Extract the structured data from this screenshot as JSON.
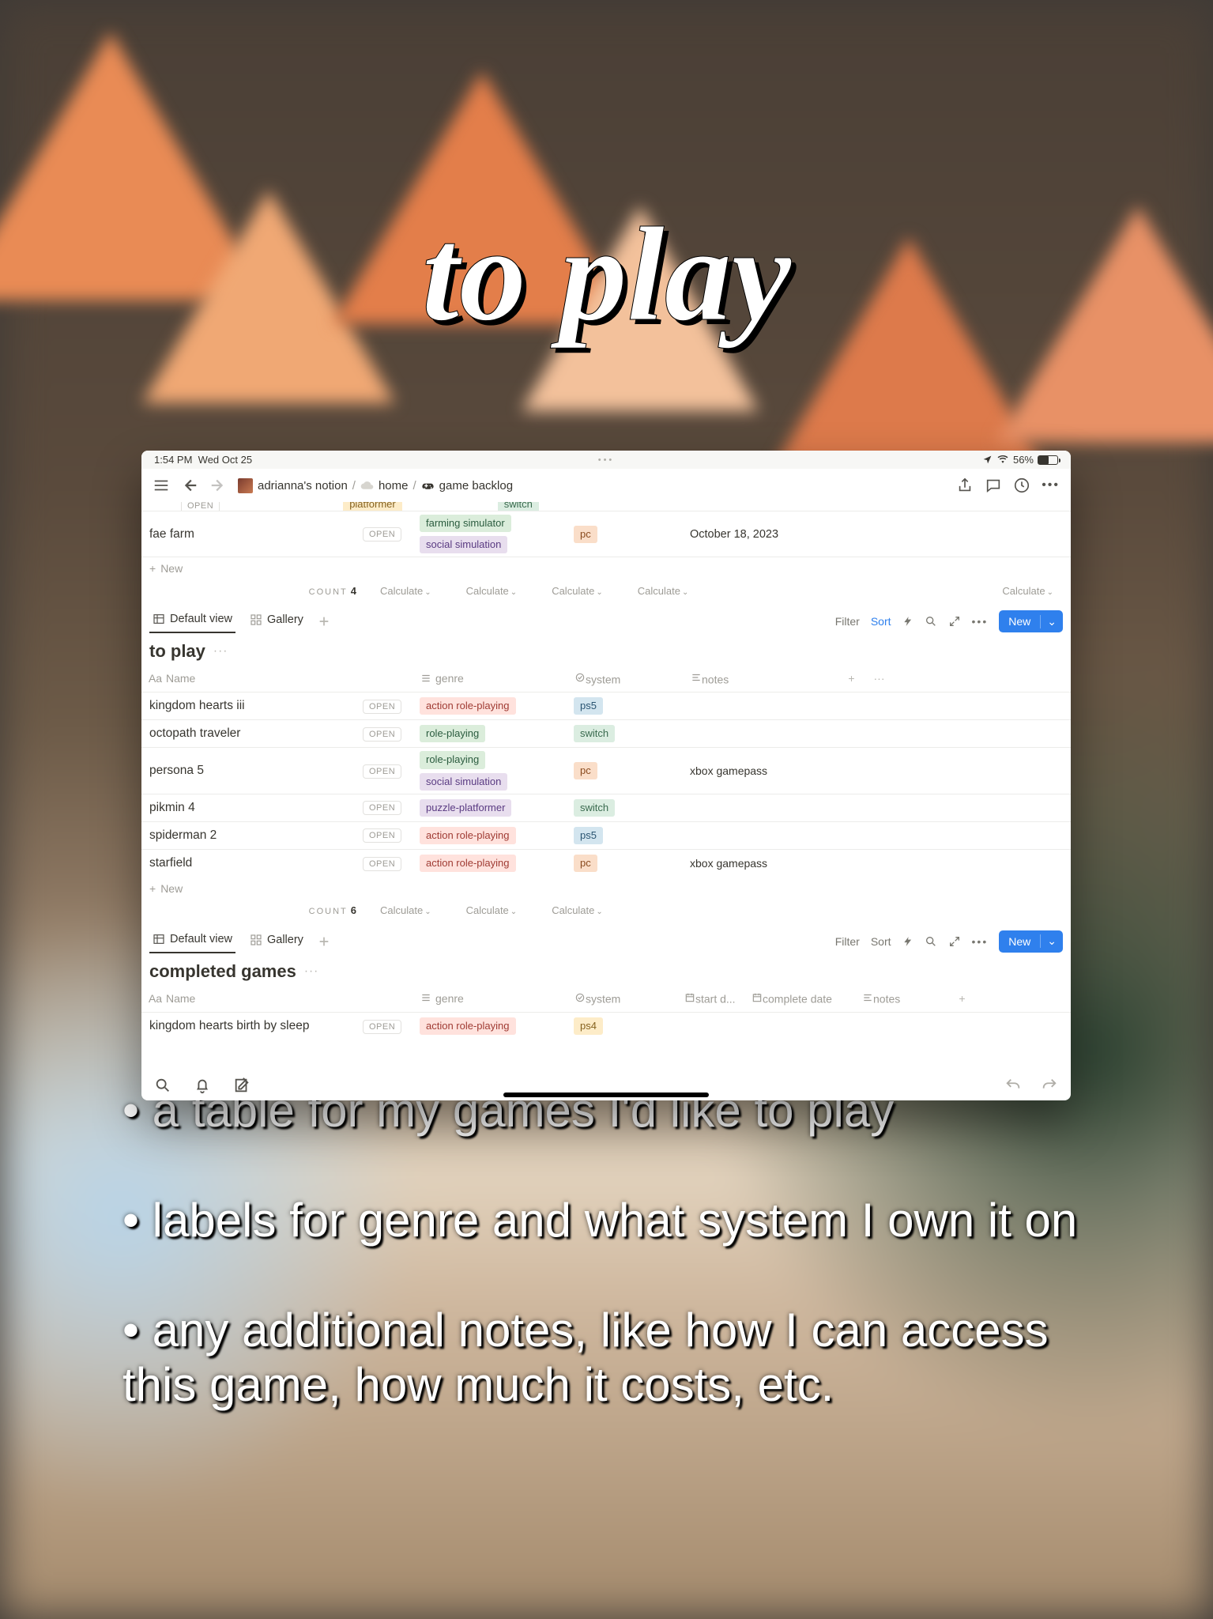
{
  "overlay": {
    "title": "to play",
    "bullets": [
      "• a table for my games I'd like to play",
      "• labels for genre and what system I own it on",
      "• any additional notes, like how I can access this game, how much it costs, etc."
    ]
  },
  "status": {
    "time": "1:54 PM",
    "date": "Wed Oct 25",
    "battery": "56%"
  },
  "breadcrumbs": {
    "workspace": "adrianna's notion",
    "parent": "home",
    "page": "game backlog",
    "sep": "/"
  },
  "partialTop": {
    "name": "fae farm",
    "open": "OPEN",
    "genres": [
      {
        "label": "farming simulator",
        "color": "green"
      },
      {
        "label": "social simulation",
        "color": "purple"
      }
    ],
    "system": {
      "label": "pc",
      "color": "orange"
    },
    "date": "October 18, 2023",
    "cutoffTag": {
      "label": "switch",
      "color": "ltgreen"
    }
  },
  "new_row_label": "New",
  "count_label": "COUNT",
  "calculate_label": "Calculate",
  "topSummary": {
    "count": "4"
  },
  "views": {
    "default": "Default view",
    "gallery": "Gallery",
    "filter": "Filter",
    "sort": "Sort",
    "new": "New"
  },
  "db2": {
    "title": "to play",
    "headers": {
      "name": "Name",
      "genre": "genre",
      "system": "system",
      "notes": "notes"
    },
    "rows": [
      {
        "name": "kingdom hearts iii",
        "open": "OPEN",
        "genres": [
          {
            "label": "action role-playing",
            "color": "red"
          }
        ],
        "system": {
          "label": "ps5",
          "color": "blue"
        },
        "notes": ""
      },
      {
        "name": "octopath traveler",
        "open": "OPEN",
        "genres": [
          {
            "label": "role-playing",
            "color": "green"
          }
        ],
        "system": {
          "label": "switch",
          "color": "ltgreen"
        },
        "notes": ""
      },
      {
        "name": "persona 5",
        "open": "OPEN",
        "genres": [
          {
            "label": "role-playing",
            "color": "green"
          },
          {
            "label": "social simulation",
            "color": "purple"
          }
        ],
        "system": {
          "label": "pc",
          "color": "orange"
        },
        "notes": "xbox gamepass"
      },
      {
        "name": "pikmin 4",
        "open": "OPEN",
        "genres": [
          {
            "label": "puzzle-platformer",
            "color": "purple"
          }
        ],
        "system": {
          "label": "switch",
          "color": "ltgreen"
        },
        "notes": ""
      },
      {
        "name": "spiderman 2",
        "open": "OPEN",
        "genres": [
          {
            "label": "action role-playing",
            "color": "red"
          }
        ],
        "system": {
          "label": "ps5",
          "color": "blue"
        },
        "notes": ""
      },
      {
        "name": "starfield",
        "open": "OPEN",
        "genres": [
          {
            "label": "action role-playing",
            "color": "red"
          }
        ],
        "system": {
          "label": "pc",
          "color": "orange"
        },
        "notes": "xbox gamepass"
      }
    ],
    "count": "6"
  },
  "db3": {
    "title": "completed games",
    "headers": {
      "name": "Name",
      "genre": "genre",
      "system": "system",
      "startd": "start d...",
      "complete": "complete date",
      "notes": "notes"
    },
    "rows": [
      {
        "name": "kingdom hearts birth by sleep",
        "open": "OPEN",
        "genres": [
          {
            "label": "action role-playing",
            "color": "red"
          }
        ],
        "system": {
          "label": "ps4",
          "color": "yellow"
        }
      }
    ]
  }
}
